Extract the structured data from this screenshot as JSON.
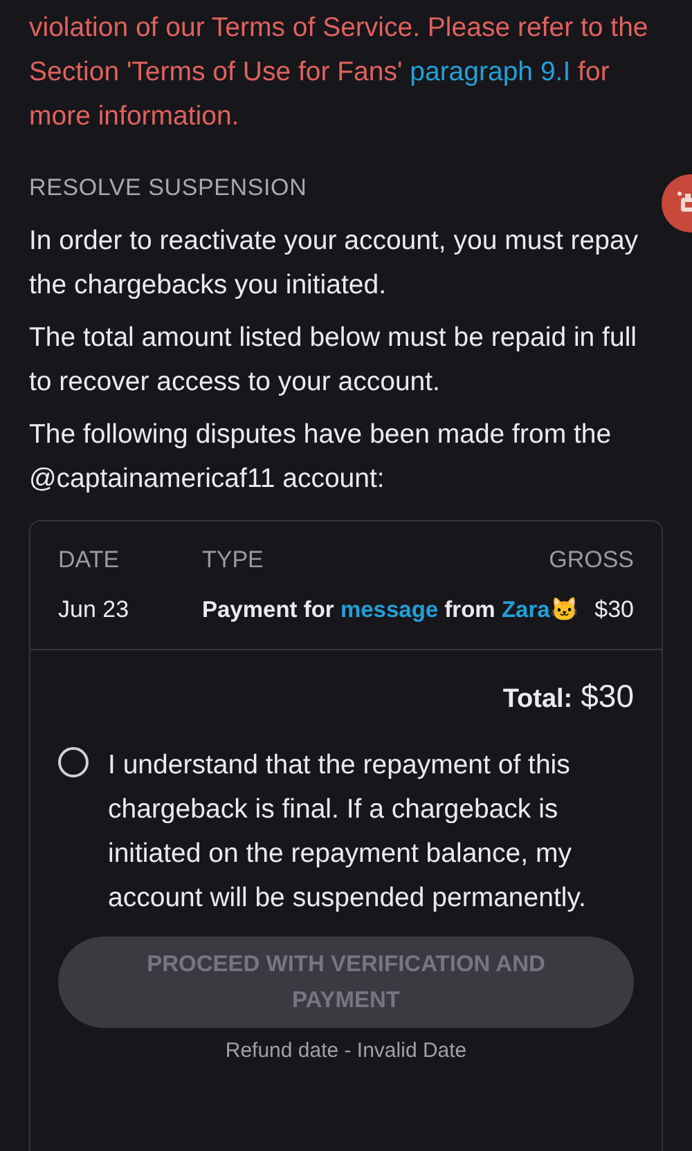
{
  "notice": {
    "before": "violation of our Terms of Service. Please refer to the Section 'Terms of Use for Fans' ",
    "link": "paragraph 9.I",
    "after": " for more information."
  },
  "section_title": "RESOLVE SUSPENSION",
  "paragraphs": [
    "In order to reactivate your account, you must repay the chargebacks you initiated.",
    "The total amount listed below must be repaid in full to recover access to your account.",
    "The following disputes have been made from the @captainamericaf11 account:"
  ],
  "table": {
    "columns": [
      "DATE",
      "TYPE",
      "GROSS"
    ],
    "rows": [
      {
        "date": "Jun 23",
        "type": {
          "before": "Payment for ",
          "link": "message",
          "middle": " from ",
          "user": "Zara🐱"
        },
        "gross": "$30"
      }
    ]
  },
  "total": {
    "label": "Total:",
    "value": "$30"
  },
  "agreement": {
    "checked": false,
    "text": "I understand that the repayment of this chargeback is final. If a chargeback is initiated on the repayment balance, my account will be suspended permanently."
  },
  "proceed_button": {
    "label": "PROCEED WITH VERIFICATION AND PAYMENT",
    "disabled": true
  },
  "refund_note": "Refund date - Invalid Date"
}
